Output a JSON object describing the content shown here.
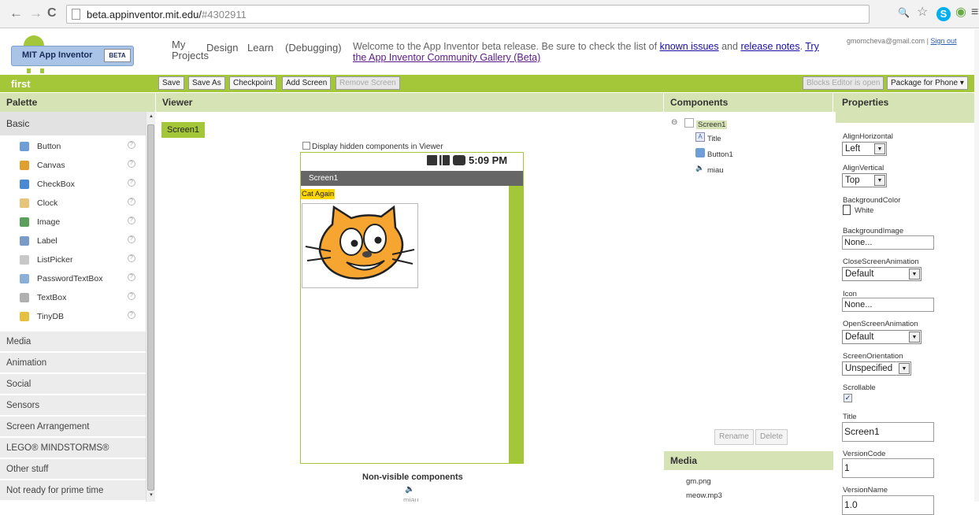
{
  "browser": {
    "url_host": "beta.appinventor.mit.edu/",
    "url_hash": "#4302911",
    "back_glyph": "←",
    "forward_glyph": "→",
    "reload_glyph": "C",
    "zoom_glyph": "🔍",
    "star_glyph": "☆",
    "skype_letter": "S",
    "eye_glyph": "◉",
    "menu_glyph": "≡"
  },
  "header": {
    "logo_name": "MIT App Inventor",
    "logo_badge": "BETA",
    "nav": [
      "My Projects",
      "Design",
      "Learn",
      "(Debugging)"
    ],
    "welcome_text": "Welcome to the App Inventor beta release. Be sure to check the list of ",
    "link_issues": "known issues",
    "and_text": " and ",
    "link_notes": "release notes",
    "dot_text": ". ",
    "link_try": "Try",
    "link_gallery": "the App Inventor Community Gallery (Beta)",
    "email": "gmomcheva@gmail.com",
    "sep": " | ",
    "sign_out": "Sign out"
  },
  "toolbar": {
    "project_name": "first",
    "save": "Save",
    "save_as": "Save As",
    "checkpoint": "Checkpoint",
    "add_screen": "Add Screen",
    "remove_screen": "Remove Screen",
    "blocks_editor": "Blocks Editor is open",
    "package": "Package for Phone ▾"
  },
  "columns": {
    "palette": "Palette",
    "viewer": "Viewer",
    "components": "Components",
    "properties": "Properties"
  },
  "palette": {
    "basic_label": "Basic",
    "items": [
      {
        "label": "Button",
        "color": "#6d9ed6"
      },
      {
        "label": "Canvas",
        "color": "#e0a030"
      },
      {
        "label": "CheckBox",
        "color": "#4a8ad4"
      },
      {
        "label": "Clock",
        "color": "#e6c47a"
      },
      {
        "label": "Image",
        "color": "#5aa05a"
      },
      {
        "label": "Label",
        "color": "#7a9ac8"
      },
      {
        "label": "ListPicker",
        "color": "#c8c8c8"
      },
      {
        "label": "PasswordTextBox",
        "color": "#8ab0d8"
      },
      {
        "label": "TextBox",
        "color": "#b0b0b0"
      },
      {
        "label": "TinyDB",
        "color": "#e6c040"
      }
    ],
    "help_glyph": "?",
    "categories": [
      "Media",
      "Animation",
      "Social",
      "Sensors",
      "Screen Arrangement",
      "LEGO® MINDSTORMS®",
      "Other stuff",
      "Not ready for prime time"
    ]
  },
  "viewer": {
    "screen_tab": "Screen1",
    "display_hidden": "Display hidden components in Viewer",
    "status_time": "5:09 PM",
    "title_bar": "Screen1",
    "cat_label": "Cat Again",
    "non_visible_title": "Non-visible components",
    "non_visible_item": "miau"
  },
  "components": {
    "tree": [
      {
        "label": "Screen1",
        "icon": "screen-icon"
      },
      {
        "label": "Title",
        "icon": "label-icon"
      },
      {
        "label": "Button1",
        "icon": "button-icon"
      },
      {
        "label": "miau",
        "icon": "sound-icon"
      }
    ],
    "collapse_glyph": "⊖",
    "rename": "Rename",
    "delete": "Delete"
  },
  "media": {
    "title": "Media",
    "items": [
      "gm.png",
      "meow.mp3"
    ]
  },
  "properties": {
    "align_horizontal_label": "AlignHorizontal",
    "align_horizontal": "Left",
    "align_vertical_label": "AlignVertical",
    "align_vertical": "Top",
    "bg_color_label": "BackgroundColor",
    "bg_color": "White",
    "bg_image_label": "BackgroundImage",
    "bg_image": "None...",
    "close_anim_label": "CloseScreenAnimation",
    "close_anim": "Default",
    "icon_label": "Icon",
    "icon": "None...",
    "open_anim_label": "OpenScreenAnimation",
    "open_anim": "Default",
    "orientation_label": "ScreenOrientation",
    "orientation": "Unspecified",
    "scrollable_label": "Scrollable",
    "check_glyph": "✓",
    "title_label": "Title",
    "title": "Screen1",
    "version_code_label": "VersionCode",
    "version_code": "1",
    "version_name_label": "VersionName",
    "version_name": "1.0"
  },
  "colors": {
    "brand_green": "#a4c639",
    "header_green": "#d6e3b4",
    "cat_orange": "#f7a531",
    "label_yellow": "#ffd700"
  }
}
